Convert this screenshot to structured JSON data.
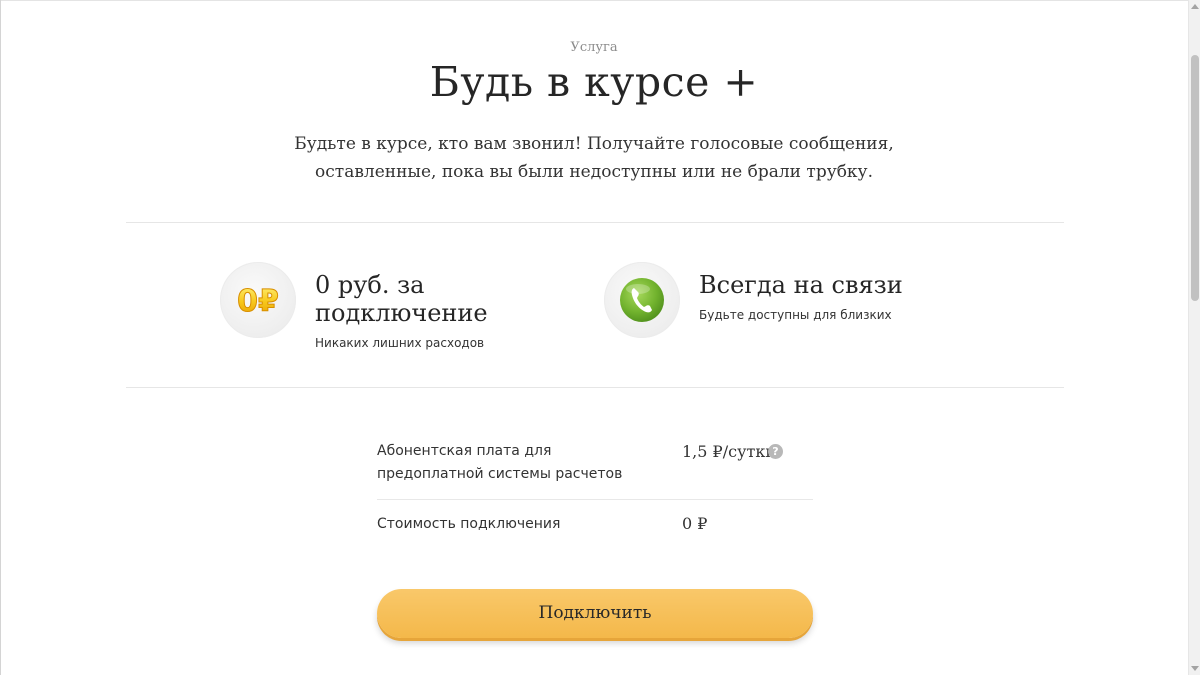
{
  "service": {
    "eyebrow": "Услуга",
    "title": "Будь в курсе +",
    "description": "Будьте в курсе, кто вам звонил! Получайте голосовые сообщения, оставленные, пока вы были недоступны или не брали трубку."
  },
  "features": [
    {
      "icon": "ruble-coin-icon",
      "icon_text": "0₽",
      "title": "0 руб. за подключение",
      "subtitle": "Никаких лишних расходов"
    },
    {
      "icon": "phone-icon",
      "title": "Всегда на связи",
      "subtitle": "Будьте доступны для близких"
    }
  ],
  "pricing": [
    {
      "label": "Абонентская плата для предоплатной системы расчетов",
      "value": "1,5 ₽/сутки",
      "help_icon": "?"
    },
    {
      "label": "Стоимость подключения",
      "value": "0 ₽"
    }
  ],
  "button": {
    "label": "Подключить"
  },
  "colors": {
    "accent": "#f6bc55",
    "phone_green": "#7ab83a",
    "coin_gold": "#f5c400"
  }
}
